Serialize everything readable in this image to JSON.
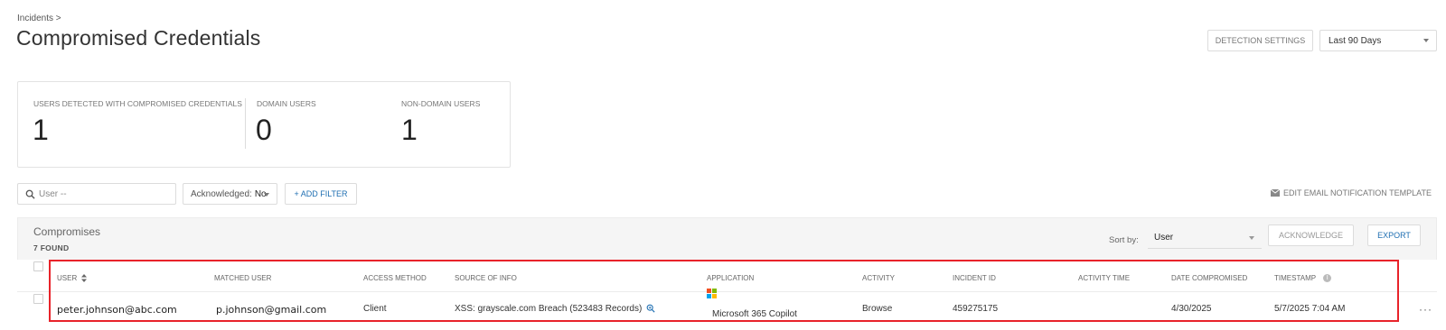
{
  "breadcrumb": "Incidents >",
  "page_title": "Compromised Credentials",
  "header": {
    "detection_settings_label": "DETECTION SETTINGS",
    "range_value": "Last 90 Days"
  },
  "stats": {
    "users_label": "USERS DETECTED WITH COMPROMISED CREDENTIALS",
    "users_value": "1",
    "domain_label": "DOMAIN USERS",
    "domain_value": "0",
    "nondomain_label": "NON-DOMAIN USERS",
    "nondomain_value": "1"
  },
  "filters": {
    "search_placeholder": "User --",
    "ack_label": "Acknowledged:",
    "ack_value": "No",
    "add_filter_label": "+ ADD FILTER",
    "edit_email_label": "EDIT EMAIL NOTIFICATION TEMPLATE"
  },
  "panel": {
    "title": "Compromises",
    "found": "7 FOUND",
    "sort_label": "Sort by:",
    "sort_value": "User",
    "acknowledge_label": "ACKNOWLEDGE",
    "export_label": "EXPORT"
  },
  "table": {
    "columns": {
      "user": "USER",
      "matched_user": "MATCHED USER",
      "access_method": "ACCESS METHOD",
      "source": "SOURCE OF INFO",
      "application": "APPLICATION",
      "activity": "ACTIVITY",
      "incident_id": "INCIDENT ID",
      "activity_time": "ACTIVITY TIME",
      "date_compromised": "DATE COMPROMISED",
      "timestamp": "TIMESTAMP"
    },
    "rows": [
      {
        "user": "peter.johnson@abc.com",
        "matched_user": "p.johnson@gmail.com",
        "access_method": "Client",
        "source": "XSS: grayscale.com Breach (523483 Records)",
        "application": "Microsoft 365 Copilot",
        "activity": "Browse",
        "incident_id": "459275175",
        "activity_time": "",
        "date_compromised": "4/30/2025",
        "timestamp": "5/7/2025 7:04 AM",
        "menu": "···"
      }
    ]
  },
  "colors": {
    "accent_blue": "#1f6fb2",
    "highlight_red": "#e8232a",
    "ms_red": "#f25022",
    "ms_green": "#7fba00",
    "ms_blue": "#00a4ef",
    "ms_yellow": "#ffb900"
  }
}
